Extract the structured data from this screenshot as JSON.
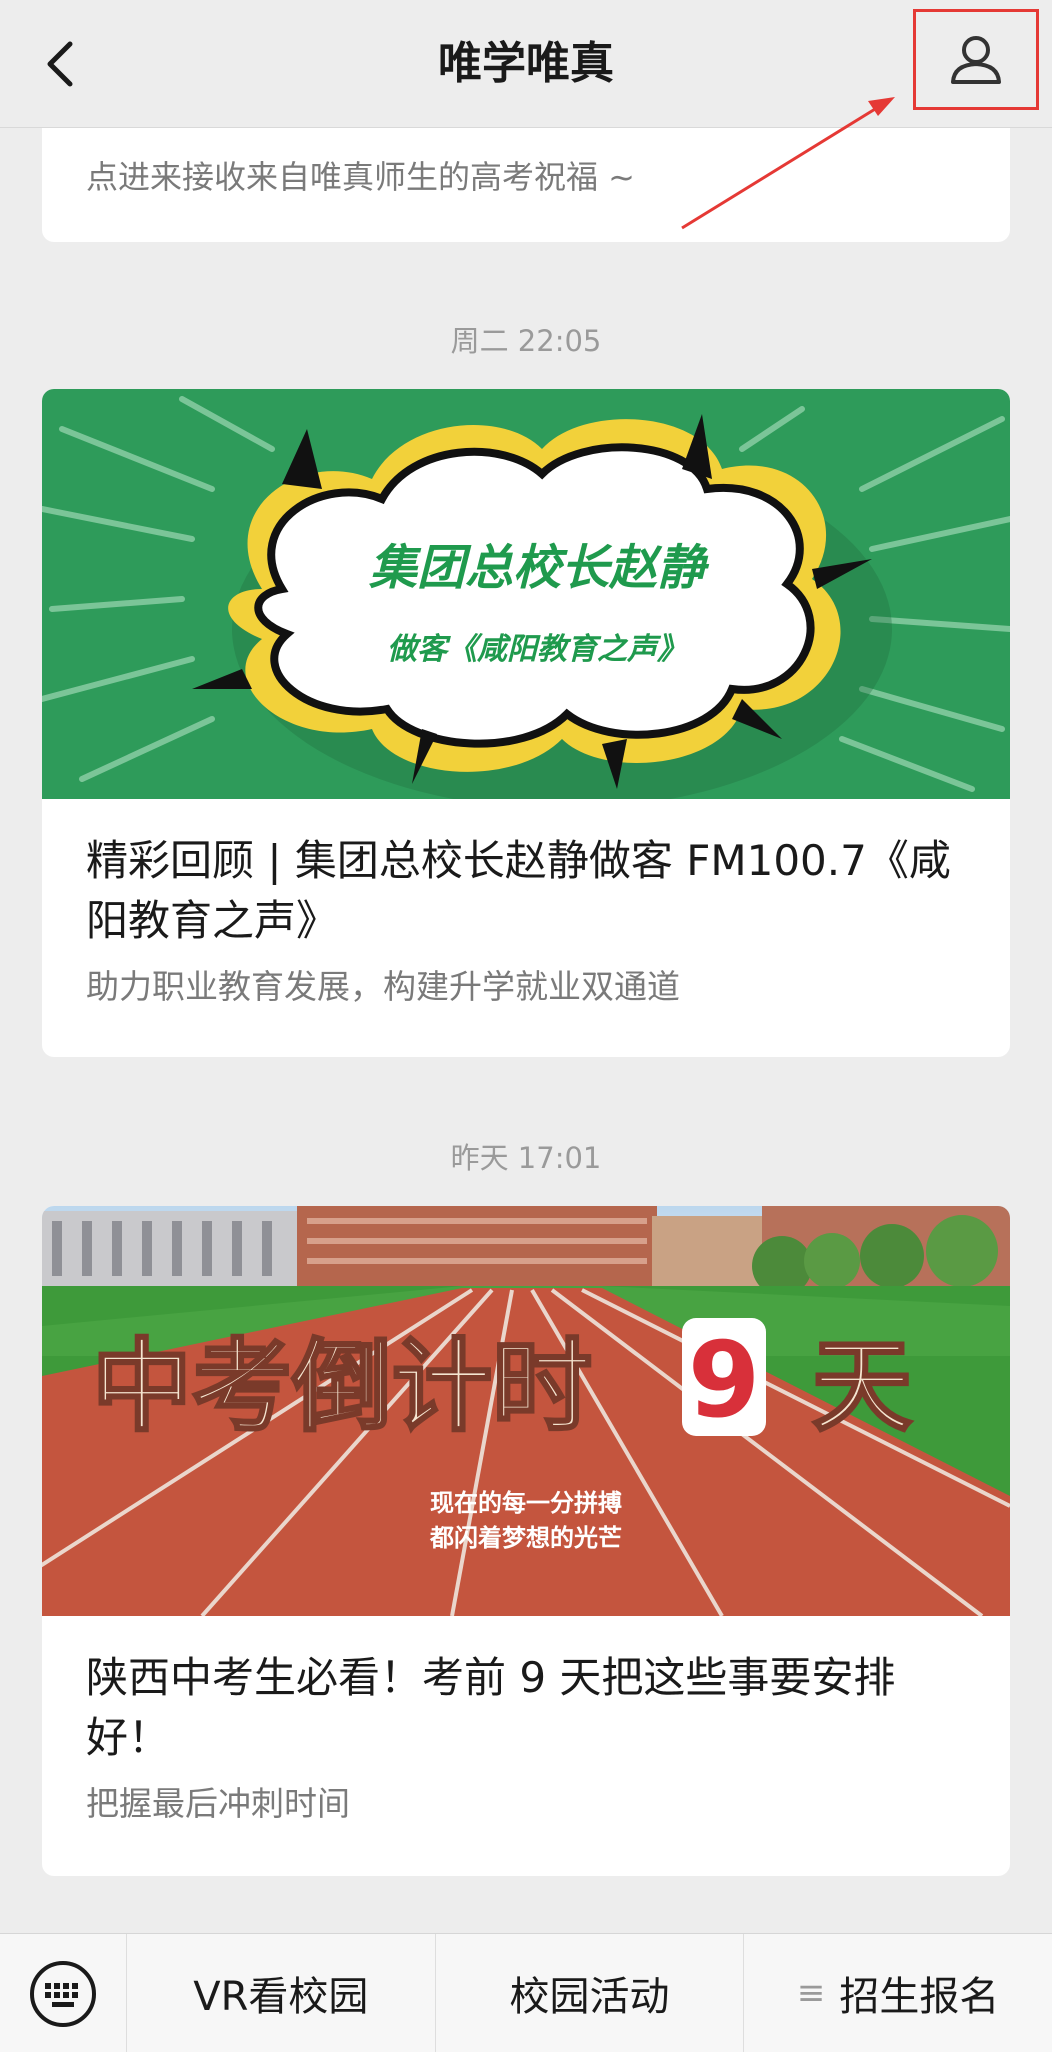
{
  "header": {
    "title": "唯学唯真",
    "back_icon": "chevron-left-icon",
    "profile_icon": "person-icon"
  },
  "colors": {
    "highlight_box": "#e53935",
    "banner_green": "#2e9b5a",
    "banner_yellow": "#f2d13a"
  },
  "feed": {
    "partial_item": {
      "description": "点进来接收来自唯真师生的高考祝福 ~"
    },
    "items": [
      {
        "timestamp": "周二 22:05",
        "banner": {
          "headline": "集团总校长赵静",
          "subline": "做客《咸阳教育之声》"
        },
        "title": "精彩回顾 | 集团总校长赵静做客 FM100.7《咸阳教育之声》",
        "description": "助力职业教育发展，构建升学就业双通道"
      },
      {
        "timestamp": "昨天 17:01",
        "banner": {
          "headline_part1": "中考倒计时",
          "headline_number": "9",
          "headline_part2": "天",
          "slogan_line1": "现在的每一分拼搏",
          "slogan_line2": "都闪着梦想的光芒"
        },
        "title": "陕西中考生必看！考前 9 天把这些事要安排好！",
        "description": "把握最后冲刺时间"
      }
    ]
  },
  "bottom_menu": {
    "keyboard_icon": "keyboard-icon",
    "items": [
      {
        "label": "VR看校园"
      },
      {
        "label": "校园活动"
      },
      {
        "label": "招生报名",
        "icon": "menu-lines-icon"
      }
    ]
  }
}
